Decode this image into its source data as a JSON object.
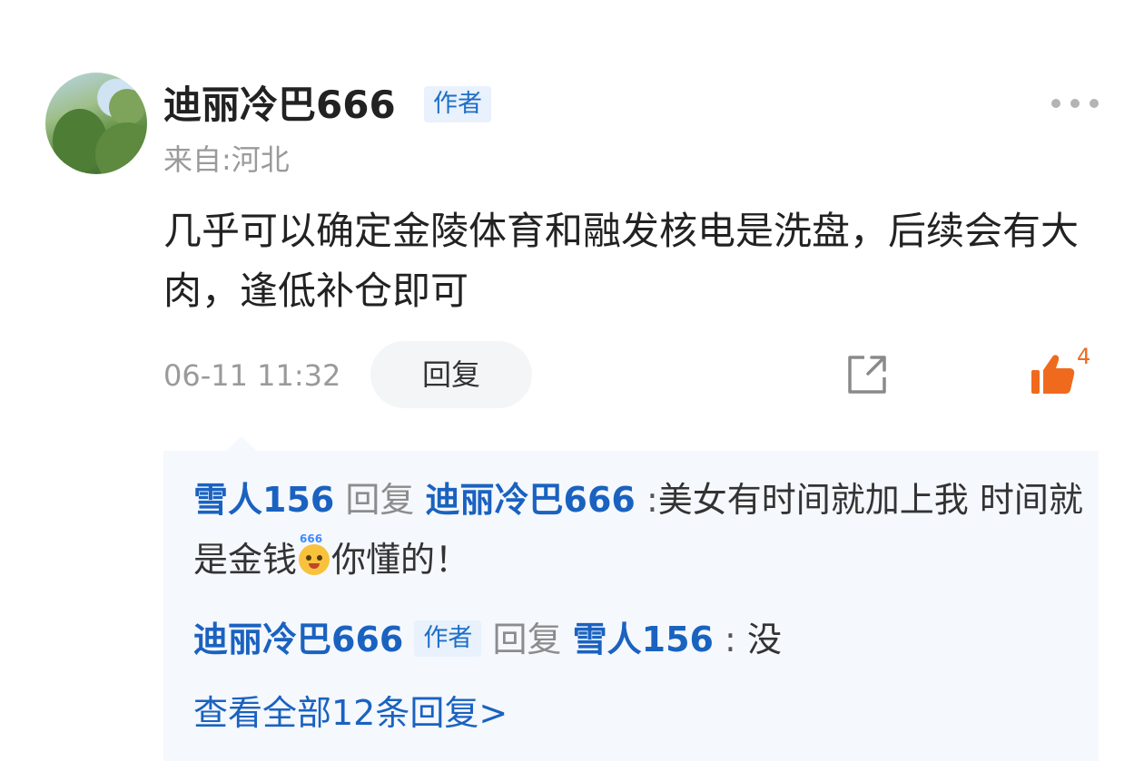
{
  "post": {
    "username": "迪丽冷巴666",
    "author_badge": "作者",
    "location": "来自:河北",
    "content": "几乎可以确定金陵体育和融发核电是洗盘，后续会有大肉，逢低补仓即可",
    "timestamp": "06-11 11:32",
    "reply_label": "回复",
    "like_count": "4"
  },
  "replies": [
    {
      "from": "雪人156",
      "verb": "回复",
      "to": "迪丽冷巴666",
      "colon": ":",
      "text_before_emoji": "美女有时间就加上我 时间就是金钱",
      "emoji_label": "666",
      "text_after_emoji": "你懂的！"
    },
    {
      "from": "迪丽冷巴666",
      "badge": "作者",
      "verb": "回复",
      "to": "雪人156",
      "colon": ":",
      "text": "没"
    }
  ],
  "view_all": "查看全部12条回复>",
  "colors": {
    "link_blue": "#1a62c0",
    "badge_bg": "#e8f1fc",
    "like_orange": "#f06a1e",
    "reply_bg": "#f5f8fc"
  },
  "icons": {
    "more": "more-dots-icon",
    "share": "share-icon",
    "like": "thumbs-up-icon"
  }
}
